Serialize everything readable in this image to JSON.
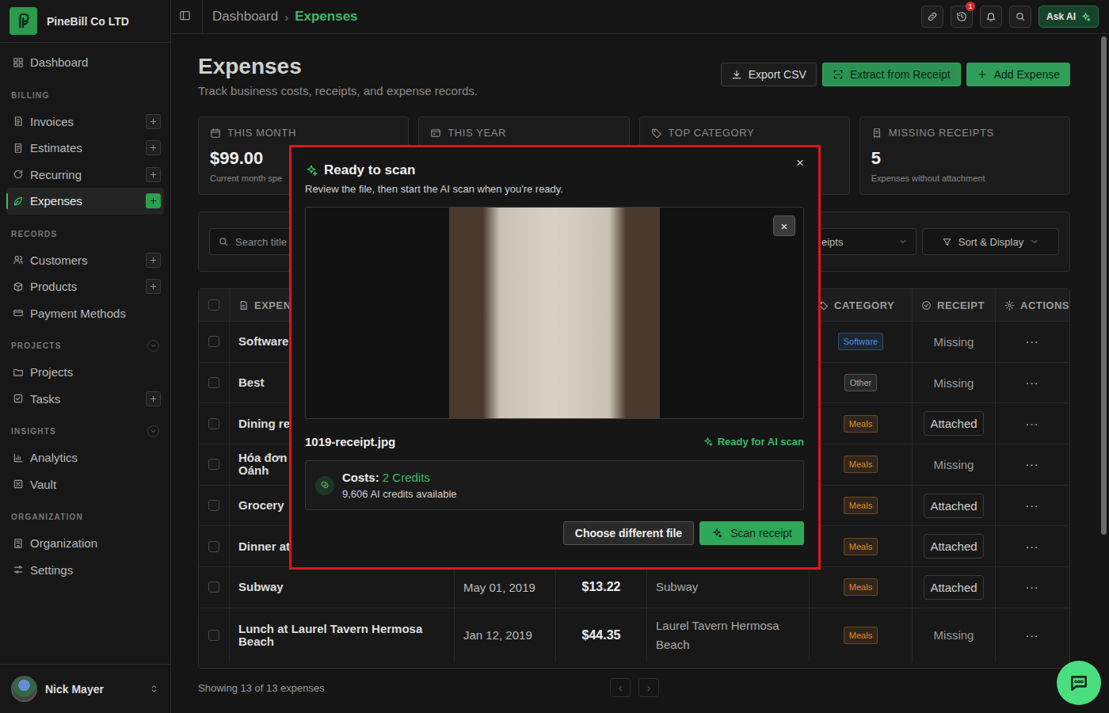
{
  "brand": {
    "name": "PineBill Co LTD"
  },
  "sidebar": {
    "top_items": [
      {
        "label": "Dashboard",
        "selected": false,
        "add": false
      }
    ],
    "groups": [
      {
        "heading": "BILLING",
        "collapsible": false,
        "items": [
          {
            "label": "Invoices",
            "selected": false,
            "add": true
          },
          {
            "label": "Estimates",
            "selected": false,
            "add": true
          },
          {
            "label": "Recurring",
            "selected": false,
            "add": true
          },
          {
            "label": "Expenses",
            "selected": true,
            "add": true
          }
        ]
      },
      {
        "heading": "RECORDS",
        "collapsible": false,
        "items": [
          {
            "label": "Customers",
            "selected": false,
            "add": true
          },
          {
            "label": "Products",
            "selected": false,
            "add": true
          },
          {
            "label": "Payment Methods",
            "selected": false,
            "add": false
          }
        ]
      },
      {
        "heading": "PROJECTS",
        "collapsible": true,
        "items": [
          {
            "label": "Projects",
            "selected": false,
            "add": false
          },
          {
            "label": "Tasks",
            "selected": false,
            "add": true
          }
        ]
      },
      {
        "heading": "INSIGHTS",
        "collapsible": true,
        "items": [
          {
            "label": "Analytics",
            "selected": false,
            "add": false
          },
          {
            "label": "Vault",
            "selected": false,
            "add": false
          }
        ]
      },
      {
        "heading": "ORGANIZATION",
        "collapsible": false,
        "items": [
          {
            "label": "Organization",
            "selected": false,
            "add": false
          },
          {
            "label": "Settings",
            "selected": false,
            "add": false
          }
        ]
      }
    ],
    "user": {
      "name": "Nick Mayer"
    }
  },
  "topbar": {
    "breadcrumbs": [
      {
        "label": "Dashboard",
        "selected": false
      },
      {
        "label": "Expenses",
        "selected": true
      }
    ],
    "separator": "›",
    "notification_count": "1",
    "ask_ai": "Ask AI"
  },
  "page": {
    "title": "Expenses",
    "subtitle": "Track business costs, receipts, and expense records.",
    "buttons": [
      {
        "label": "Export CSV",
        "kind": "outline"
      },
      {
        "label": "Extract from Receipt",
        "kind": "primary-soft"
      },
      {
        "label": "Add Expense",
        "kind": "primary"
      }
    ]
  },
  "stats": [
    {
      "label": "THIS MONTH",
      "value": "$99.00",
      "note": "Current month spe"
    },
    {
      "label": "THIS YEAR"
    },
    {
      "label": "TOP CATEGORY"
    },
    {
      "label": "MISSING RECEIPTS",
      "value": "5",
      "note": "Expenses without attachment"
    }
  ],
  "filters": {
    "search_placeholder": "Search title",
    "select_text": "eipts",
    "sort_label": "Sort & Display"
  },
  "table": {
    "header_checked": false,
    "columns": [
      {
        "label": "EXPEN"
      },
      {
        "label": "CATEGORY"
      },
      {
        "label": "RECEIPT"
      },
      {
        "label": "ACTIONS"
      }
    ],
    "rows": [
      {
        "checked": false,
        "title": [
          "Software"
        ],
        "category": "Software",
        "color": "#4a90e2",
        "receipt": "Missing",
        "attached": false,
        "action": "···"
      },
      {
        "checked": false,
        "title": [
          "Best"
        ],
        "category": "Other",
        "color": "#a8a8a8",
        "receipt": "Missing",
        "attached": false,
        "action": "···"
      },
      {
        "checked": false,
        "title": [
          "Dining re"
        ],
        "category": "Meals",
        "color": "#e0892a",
        "receipt": "Attached",
        "attached": true,
        "action": "···"
      },
      {
        "checked": false,
        "title": [
          "Hóa đơn",
          "Oánh"
        ],
        "category": "Meals",
        "color": "#e0892a",
        "receipt": "Missing",
        "attached": false,
        "action": "···"
      },
      {
        "checked": false,
        "title": [
          "Grocery"
        ],
        "category": "Meals",
        "color": "#e0892a",
        "receipt": "Attached",
        "attached": true,
        "action": "···"
      },
      {
        "checked": false,
        "title": [
          "Dinner at"
        ],
        "category": "Meals",
        "color": "#e0892a",
        "receipt": "Attached",
        "attached": true,
        "action": "···"
      },
      {
        "checked": false,
        "title": [
          "Subway"
        ],
        "date": "May 01, 2019",
        "amount": "$13.22",
        "vendor": [
          "Subway"
        ],
        "category": "Meals",
        "color": "#e0892a",
        "receipt": "Attached",
        "attached": true,
        "action": "···"
      },
      {
        "checked": false,
        "title": [
          "Lunch at Laurel Tavern Hermosa",
          "Beach"
        ],
        "date": "Jan 12, 2019",
        "amount": "$44.35",
        "vendor": [
          "Laurel Tavern Hermosa",
          "Beach"
        ],
        "category": "Meals",
        "color": "#e0892a",
        "receipt": "Missing",
        "attached": false,
        "action": "···"
      }
    ],
    "footer": "Showing 13 of 13 expenses",
    "pager": [
      {
        "label": "‹",
        "disabled": true
      },
      {
        "label": "›",
        "disabled": true
      }
    ]
  },
  "modal": {
    "title": "Ready to scan",
    "subtitle": "Review the file, then start the AI scan when you're ready.",
    "close": "×",
    "remove": "×",
    "filename": "1019-receipt.jpg",
    "status": "Ready for AI scan",
    "cost_label": "Costs:",
    "cost_value": "2 Credits",
    "credits": "9,606 AI credits available",
    "buttons": [
      {
        "label": "Choose different file",
        "kind": "secondary"
      },
      {
        "label": "Scan receipt",
        "kind": "primary"
      }
    ]
  },
  "scrollbar": {
    "level": 0.74
  }
}
